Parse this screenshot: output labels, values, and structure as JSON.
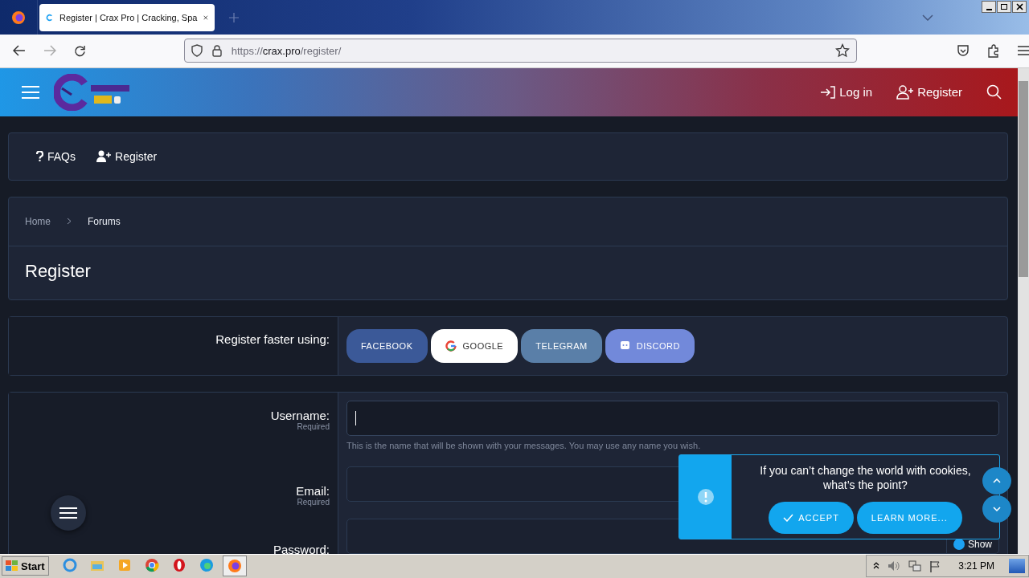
{
  "browser": {
    "tab_title": "Register | Crax Pro | Cracking, Spa",
    "url_prefix": "https://",
    "url_host": "crax.pro",
    "url_path": "/register/"
  },
  "site_header": {
    "actions": [
      {
        "label": "Log in",
        "kind": "login"
      },
      {
        "label": "Register",
        "kind": "register"
      }
    ]
  },
  "subnav": [
    {
      "label": "FAQs",
      "kind": "faq"
    },
    {
      "label": "Register",
      "kind": "register"
    }
  ],
  "breadcrumb": [
    {
      "label": "Home",
      "selected": false
    },
    {
      "label": "Forums",
      "selected": true
    }
  ],
  "page_title": "Register",
  "social": {
    "label": "Register faster using:",
    "buttons": [
      {
        "label": "FACEBOOK",
        "kind": "facebook"
      },
      {
        "label": "GOOGLE",
        "kind": "google"
      },
      {
        "label": "TELEGRAM",
        "kind": "telegram"
      },
      {
        "label": "DISCORD",
        "kind": "discord"
      }
    ]
  },
  "form": [
    {
      "label": "Username:",
      "note": "Required",
      "hint": "This is the name that will be shown with your messages. You may use any name you wish.",
      "focused": true
    },
    {
      "label": "Email:",
      "note": "Required",
      "focused": false
    },
    {
      "label": "Password:",
      "toggle": "Show",
      "focused": false
    }
  ],
  "cookie": {
    "message": "If you can’t change the world with cookies, what’s the point?",
    "buttons": [
      {
        "label": "ACCEPT",
        "kind": "accept"
      },
      {
        "label": "LEARN MORE...",
        "kind": "learn"
      }
    ]
  },
  "taskbar": {
    "start": "Start",
    "clock": "3:21 PM"
  }
}
